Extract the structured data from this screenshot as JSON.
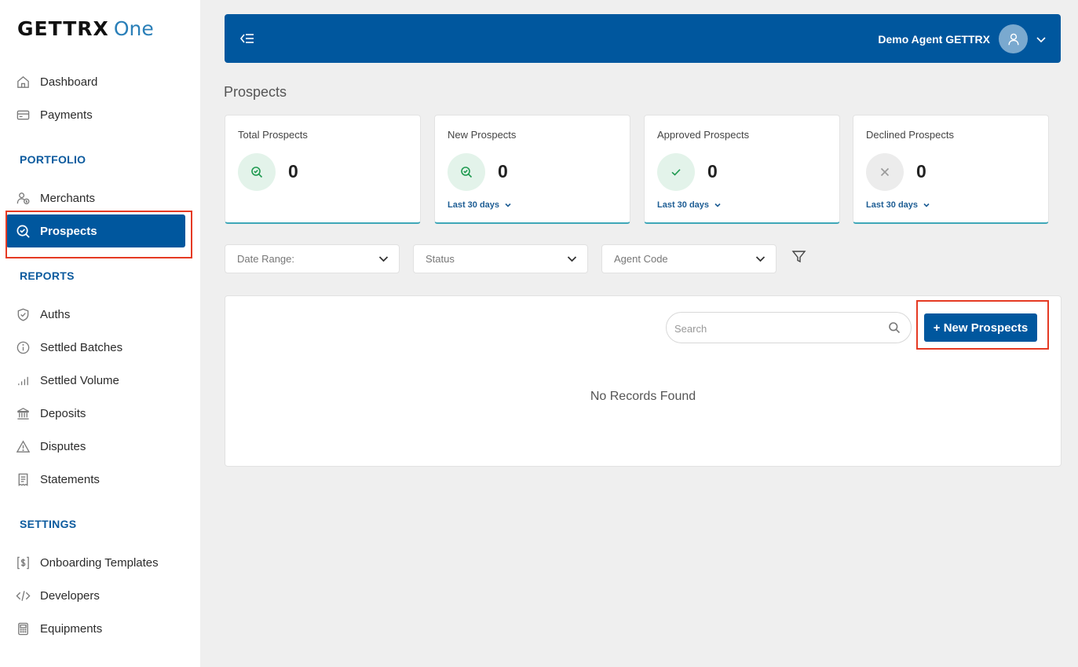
{
  "logo": {
    "main": "GETTRX",
    "sub": "One"
  },
  "sidebar": {
    "top_items": [
      {
        "label": "Dashboard",
        "icon": "home-icon"
      },
      {
        "label": "Payments",
        "icon": "card-icon"
      }
    ],
    "portfolio_title": "PORTFOLIO",
    "portfolio_items": [
      {
        "label": "Merchants",
        "icon": "merchants-icon"
      },
      {
        "label": "Prospects",
        "icon": "prospects-search-icon",
        "active": true
      }
    ],
    "reports_title": "REPORTS",
    "reports_items": [
      {
        "label": "Auths",
        "icon": "shield-check-icon"
      },
      {
        "label": "Settled Batches",
        "icon": "info-circle-icon"
      },
      {
        "label": "Settled Volume",
        "icon": "bar-signal-icon"
      },
      {
        "label": "Deposits",
        "icon": "bank-icon"
      },
      {
        "label": "Disputes",
        "icon": "warning-icon"
      },
      {
        "label": "Statements",
        "icon": "receipt-icon"
      }
    ],
    "settings_title": "SETTINGS",
    "settings_items": [
      {
        "label": "Onboarding Templates",
        "icon": "dollar-doc-icon"
      },
      {
        "label": "Developers",
        "icon": "code-icon"
      },
      {
        "label": "Equipments",
        "icon": "terminal-icon"
      }
    ]
  },
  "header": {
    "user_name": "Demo Agent GETTRX"
  },
  "page": {
    "title": "Prospects"
  },
  "stats": [
    {
      "label": "Total Prospects",
      "value": "0",
      "range": "",
      "icon": "search-check-icon"
    },
    {
      "label": "New Prospects",
      "value": "0",
      "range": "Last 30 days",
      "icon": "search-check-icon"
    },
    {
      "label": "Approved Prospects",
      "value": "0",
      "range": "Last 30 days",
      "icon": "check-icon"
    },
    {
      "label": "Declined Prospects",
      "value": "0",
      "range": "Last 30 days",
      "icon": "x-icon"
    }
  ],
  "filters": {
    "date_range": "Date Range:",
    "status": "Status",
    "agent_code": "Agent Code"
  },
  "table": {
    "search_placeholder": "Search",
    "new_button": "+ New Prospects",
    "empty_message": "No Records Found"
  },
  "colors": {
    "primary": "#00579e",
    "highlight": "#e53a23",
    "card_accent": "#3fa7b8",
    "success": "#1f9a50"
  }
}
